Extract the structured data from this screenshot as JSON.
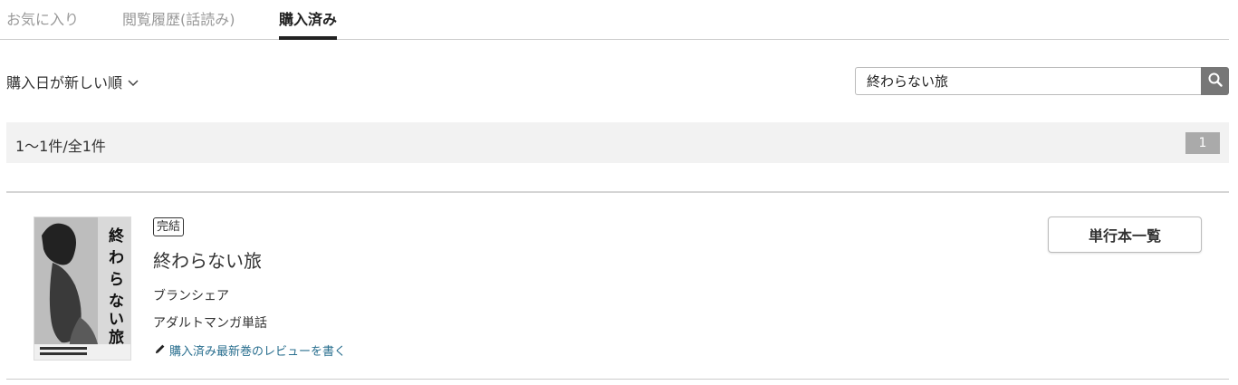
{
  "tabs": [
    {
      "label": "お気に入り"
    },
    {
      "label": "閲覧履歴(話読み)"
    },
    {
      "label": "購入済み"
    }
  ],
  "sort": {
    "label": "購入日が新しい順",
    "icon": "chevron-down-icon"
  },
  "search": {
    "value": "終わらない旅",
    "icon": "search-icon",
    "button_color": "#777777"
  },
  "results": {
    "count_text": "1〜1件/全1件",
    "page": "1"
  },
  "item": {
    "badge": "完結",
    "title": "終わらない旅",
    "author": "ブランシェア",
    "category": "アダルトマンガ単話",
    "review_link": "購入済み最新巻のレビューを書く",
    "review_icon": "pencil-icon",
    "cover_title": "終わらない旅",
    "volumes_button": "単行本一覧"
  },
  "colors": {
    "link": "#2a6f8f",
    "active_tab": "#222222",
    "inactive_tab": "#999999"
  }
}
